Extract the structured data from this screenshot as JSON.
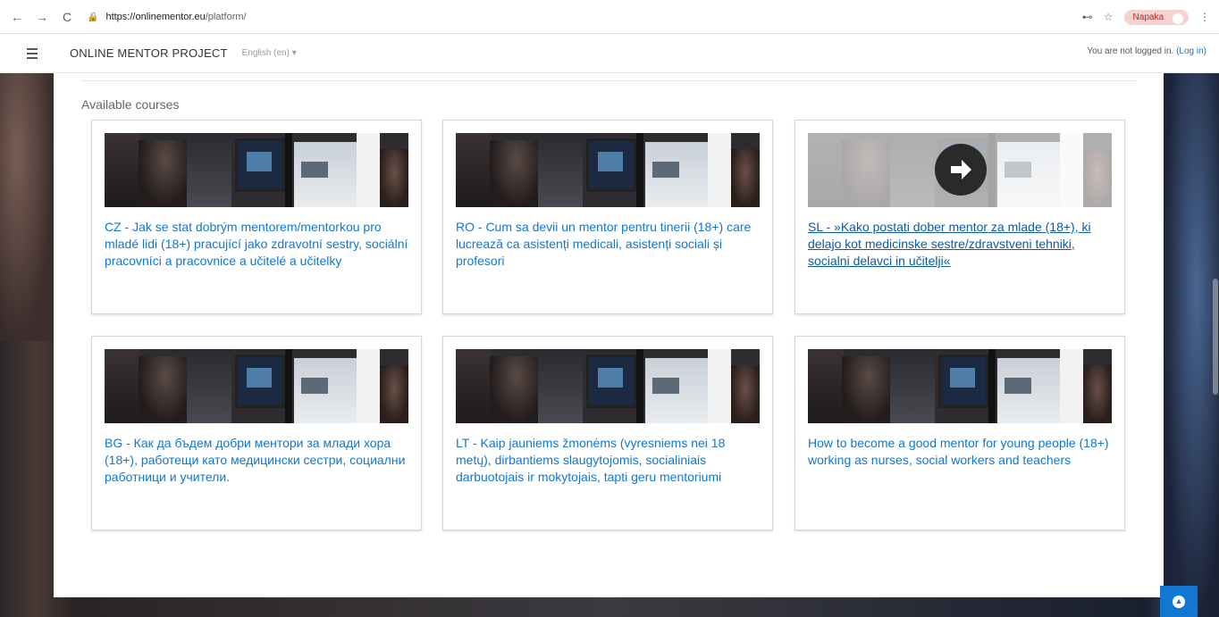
{
  "browser": {
    "nav": {
      "back": "←",
      "forward": "→",
      "reload": "C",
      "home": "⌂"
    },
    "url_host": "https://onlinementor.eu",
    "url_path": "/platform/",
    "key_icon": "⊷",
    "star_icon": "☆",
    "profile_label": "Napaka",
    "menu_icon": "⋮"
  },
  "navbar": {
    "brand": "ONLINE MENTOR PROJECT",
    "language": "English (en) ▾",
    "login_text": "You are not logged in.",
    "login_link": "(Log in)"
  },
  "main": {
    "section_title": "Available courses",
    "courses": [
      {
        "title": "CZ - Jak se stat dobrým mentorem/mentorkou pro mladé lidi (18+) pracující jako zdravotní sestry, sociální pracovníci a pracovnice a učitelé a učitelky"
      },
      {
        "title": "RO - Cum sa devii un mentor pentru tinerii (18+) care lucrează ca asistenți medicali, asistenți sociali și profesori"
      },
      {
        "title": "SL - »Kako postati dober mentor za mlade (18+), ki delajo kot medicinske sestre/zdravstveni tehniki, socialni delavci in učitelji«"
      },
      {
        "title": "BG - Как да бъдем добри ментори за млади хора (18+), работещи като медицински сестри, социални работници и учители."
      },
      {
        "title": "LT - Kaip jauniems žmonėms (vyresniems nei 18 metų), dirbantiems slaugytojomis, socialiniais darbuotojais ir mokytojais, tapti geru mentoriumi"
      },
      {
        "title": "How to become a good mentor for young people (18+) working as nurses, social workers and teachers"
      }
    ]
  },
  "colors": {
    "link": "#1177d1",
    "accent": "#1177d1"
  },
  "icons": {
    "scroll_top": "chevron-up-icon",
    "course_enter": "arrow-right-circle-icon"
  }
}
